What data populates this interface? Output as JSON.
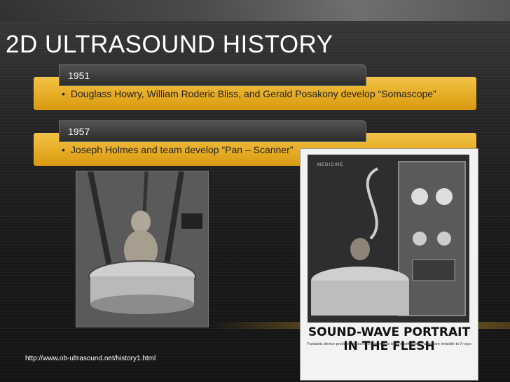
{
  "slide": {
    "title": "2D ULTRASOUND HISTORY",
    "items": [
      {
        "year": "1951",
        "bullet": "Douglass Howry, William Roderic Bliss, and Gerald Posakony develop “Somascope”"
      },
      {
        "year": "1957",
        "bullet": "Joseph Holmes and team develop “Pan – Scanner”"
      }
    ],
    "source_url": "http://www.ob-ultrasound.net/history1.html"
  },
  "photos": {
    "left": {
      "alt": "Man seated in early ultrasound tank apparatus"
    },
    "right": {
      "section_label": "MEDICINE",
      "headline": "SOUND-WAVE PORTRAIT IN THE FLESH",
      "subheadline": "Fantastic device produces pictures of the human body's soft tissues which are invisible to X-rays"
    }
  },
  "colors": {
    "accent_bar": "#e6ac25",
    "background": "#1c1c1c",
    "title_text": "#ffffff"
  }
}
